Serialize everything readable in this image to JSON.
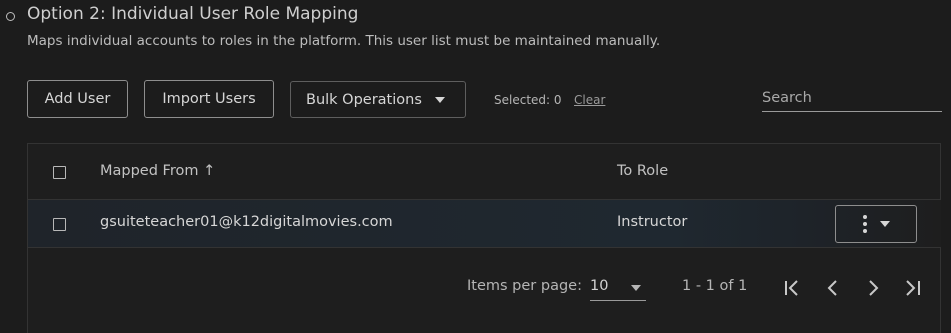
{
  "option": {
    "title": "Option 2: Individual User Role Mapping",
    "description": "Maps individual accounts to roles in the platform. This user list must be maintained manually."
  },
  "toolbar": {
    "add_user_label": "Add User",
    "import_users_label": "Import Users",
    "bulk_operations_label": "Bulk Operations",
    "selected_text": "Selected: 0",
    "clear_label": "Clear",
    "search_placeholder": "Search"
  },
  "table": {
    "columns": [
      "Mapped From ↑",
      "To Role"
    ],
    "rows": [
      {
        "mapped_from": "gsuiteteacher01@k12digitalmovies.com",
        "to_role": "Instructor"
      }
    ]
  },
  "pagination": {
    "items_per_page_label": "Items per page:",
    "items_per_page_value": "10",
    "range_text": "1 - 1 of 1"
  },
  "icons": {
    "radio": "radio-bullet-icon",
    "bulk_caret": "chevron-down-icon",
    "sort": "sort-ascending-icon",
    "row_menu": "kebab-menu-icon",
    "first_page": "first-page-icon",
    "prev_page": "prev-page-icon",
    "next_page": "next-page-icon",
    "last_page": "last-page-icon"
  },
  "colors": {
    "background": "#1c1c1c",
    "row_highlight": "#1f2830",
    "border": "#8e8e8e"
  }
}
